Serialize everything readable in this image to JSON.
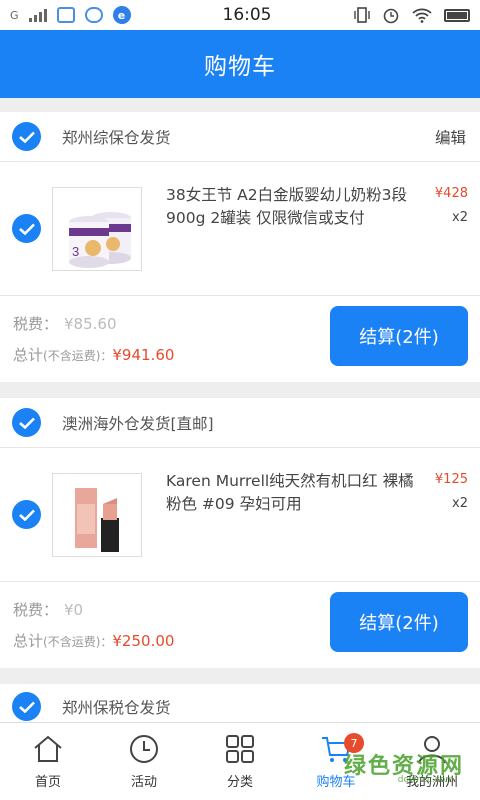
{
  "status_bar": {
    "carrier": "G",
    "time": "16:05"
  },
  "header": {
    "title": "购物车"
  },
  "shops": [
    {
      "name": "郑州综保仓发货",
      "edit_label": "编辑",
      "item": {
        "title": "38女王节 A2白金版婴幼儿奶粉3段 900g 2罐装 仅限微信或支付",
        "price": "¥428",
        "qty": "x2",
        "image": "milk-powder-cans"
      },
      "tax_label": "税费：",
      "tax_value": "¥85.60",
      "total_label": "总计",
      "total_note": "(不含运费)：",
      "total_value": "¥941.60",
      "checkout_label": "结算(2件)"
    },
    {
      "name": "澳洲海外仓发货[直邮]",
      "item": {
        "title": "Karen Murrell纯天然有机口红 裸橘粉色 #09 孕妇可用",
        "price": "¥125",
        "qty": "x2",
        "image": "lipstick"
      },
      "tax_label": "税费：",
      "tax_value": "¥0",
      "total_label": "总计",
      "total_note": "(不含运费)：",
      "total_value": "¥250.00",
      "checkout_label": "结算(2件)"
    },
    {
      "name": "郑州保税仓发货"
    }
  ],
  "tabbar": {
    "items": [
      {
        "label": "首页",
        "icon": "home-icon"
      },
      {
        "label": "活动",
        "icon": "clock-icon"
      },
      {
        "label": "分类",
        "icon": "grid-icon"
      },
      {
        "label": "购物车",
        "icon": "cart-icon",
        "badge": "7",
        "active": true
      },
      {
        "label": "我的洲州",
        "icon": "user-icon"
      }
    ]
  },
  "watermark": {
    "text": "绿色资源网",
    "sub": "downcc.com"
  },
  "colors": {
    "primary": "#1a82f5",
    "price": "#e84a2c",
    "watermark": "#46a028"
  }
}
